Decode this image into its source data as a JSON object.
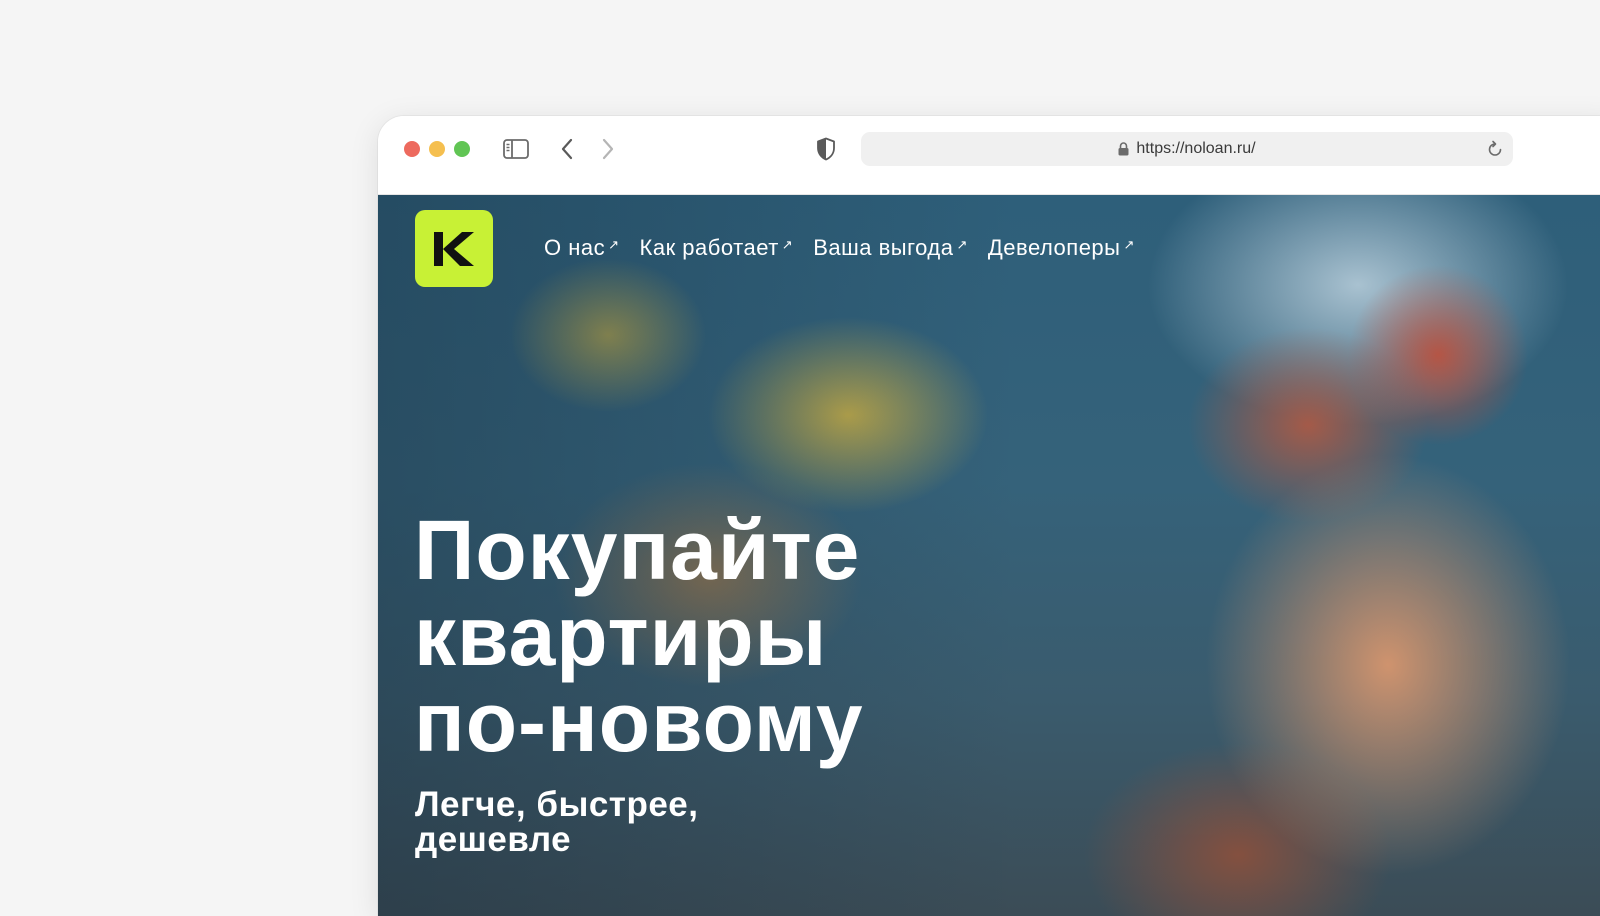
{
  "browser": {
    "url": "https://noloan.ru/",
    "icons": {
      "sidebar_toggle": "sidebar-icon",
      "back": "chevron-left-icon",
      "forward": "chevron-right-icon",
      "privacy": "shield-icon",
      "lock": "lock-icon",
      "reload": "reload-icon"
    },
    "traffic_lights": [
      "#ed6a5e",
      "#f5bf4f",
      "#61c554"
    ]
  },
  "site": {
    "logo": {
      "letter": "K",
      "background": "#c8f135"
    },
    "nav": [
      {
        "label": "О нас",
        "arrow": "↗"
      },
      {
        "label": "Как работает",
        "arrow": "↗"
      },
      {
        "label": "Ваша выгода",
        "arrow": "↗"
      },
      {
        "label": "Девелоперы",
        "arrow": "↗"
      }
    ],
    "hero": {
      "title_lines": [
        "Покупайте",
        "квартиры",
        "по-новому"
      ],
      "subtitle_lines": [
        "Легче, быстрее,",
        "дешевле"
      ]
    }
  }
}
